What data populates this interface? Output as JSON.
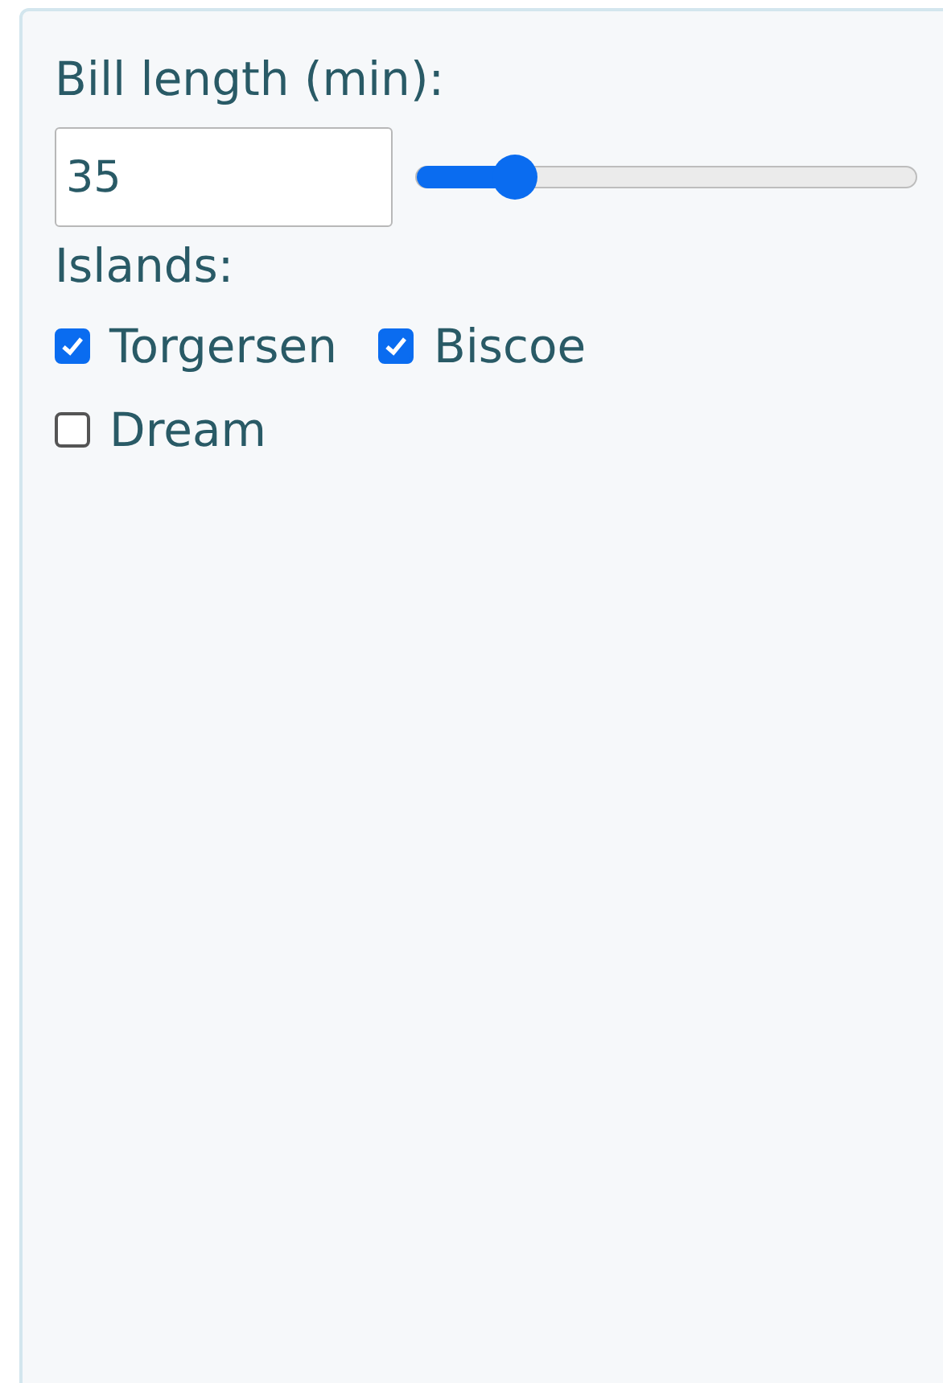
{
  "filter": {
    "label": "Bill length (min):",
    "value": "35",
    "level": 0.2
  },
  "islands": {
    "label": "Islands:",
    "options": [
      {
        "label": "Torgersen",
        "checked": true
      },
      {
        "label": "Biscoe",
        "checked": true
      },
      {
        "label": "Dream",
        "checked": false
      }
    ]
  }
}
